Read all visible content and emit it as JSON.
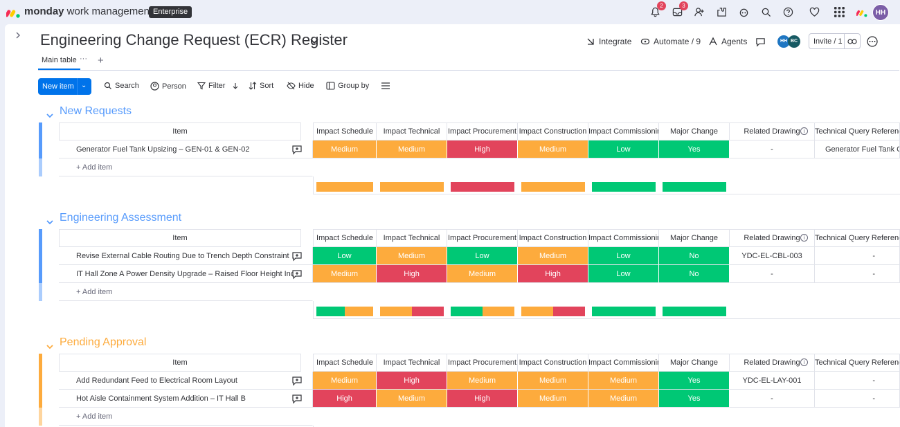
{
  "app": {
    "brand_bold": "monday",
    "brand_rest": " work management",
    "plan_badge": "Enterprise",
    "notifications_count": "2",
    "inbox_count": "3",
    "user_initials": "HH"
  },
  "board": {
    "title": "Engineering Change Request (ECR) Register",
    "integrate_label": "Integrate",
    "automate_label": "Automate / 9",
    "agents_label": "Agents",
    "member_initials": [
      "HH",
      "BC"
    ],
    "invite_label": "Invite / 1"
  },
  "tabs": {
    "main": "Main table"
  },
  "toolbar": {
    "new_item": "New item",
    "search": "Search",
    "person": "Person",
    "filter": "Filter",
    "sort": "Sort",
    "hide": "Hide",
    "group_by": "Group by"
  },
  "columns": {
    "item": "Item",
    "schedule": "Impact Schedule",
    "technical": "Impact Technical",
    "procurement": "Impact Procurement",
    "construction": "Impact Construction",
    "commissioning": "Impact Commissioning",
    "major": "Major Change",
    "drawing": "Related Drawing",
    "query": "Technical Query Reference"
  },
  "groups": [
    {
      "title": "New Requests",
      "color": "#579bfc",
      "rows": [
        {
          "name": "Generator Fuel Tank Upsizing – GEN-01 & GEN-02",
          "schedule": "Medium",
          "technical": "Medium",
          "procurement": "High",
          "construction": "Medium",
          "commissioning": "Low",
          "major": "Yes",
          "drawing": "-",
          "query": "Generator Fuel Tank Ca"
        }
      ],
      "add_item": "+ Add item"
    },
    {
      "title": "Engineering Assessment",
      "color": "#579bfc",
      "rows": [
        {
          "name": "Revise External Cable Routing Due to Trench Depth Constraint",
          "schedule": "Low",
          "technical": "Medium",
          "procurement": "Low",
          "construction": "Medium",
          "commissioning": "Low",
          "major": "No",
          "drawing": "YDC-EL-CBL-003",
          "query": "-"
        },
        {
          "name": "IT Hall Zone A Power Density Upgrade – Raised Floor Height Incr",
          "schedule": "Medium",
          "technical": "High",
          "procurement": "Medium",
          "construction": "High",
          "commissioning": "Low",
          "major": "No",
          "drawing": "-",
          "query": "-"
        }
      ],
      "add_item": "+ Add item"
    },
    {
      "title": "Pending Approval",
      "color": "#fdab3d",
      "rows": [
        {
          "name": "Add Redundant Feed to Electrical Room Layout",
          "schedule": "Medium",
          "technical": "High",
          "procurement": "Medium",
          "construction": "Medium",
          "commissioning": "Medium",
          "major": "Yes",
          "drawing": "YDC-EL-LAY-001",
          "query": "-"
        },
        {
          "name": "Hot Aisle Containment System Addition – IT Hall B",
          "schedule": "High",
          "technical": "Medium",
          "procurement": "High",
          "construction": "Medium",
          "commissioning": "Medium",
          "major": "Yes",
          "drawing": "-",
          "query": "-"
        }
      ],
      "add_item": "+ Add item"
    }
  ],
  "status_colors": {
    "High": "#e2445c",
    "Medium": "#fdab3d",
    "Low": "#00c875",
    "Yes": "#00c875",
    "No": "#00c875"
  }
}
